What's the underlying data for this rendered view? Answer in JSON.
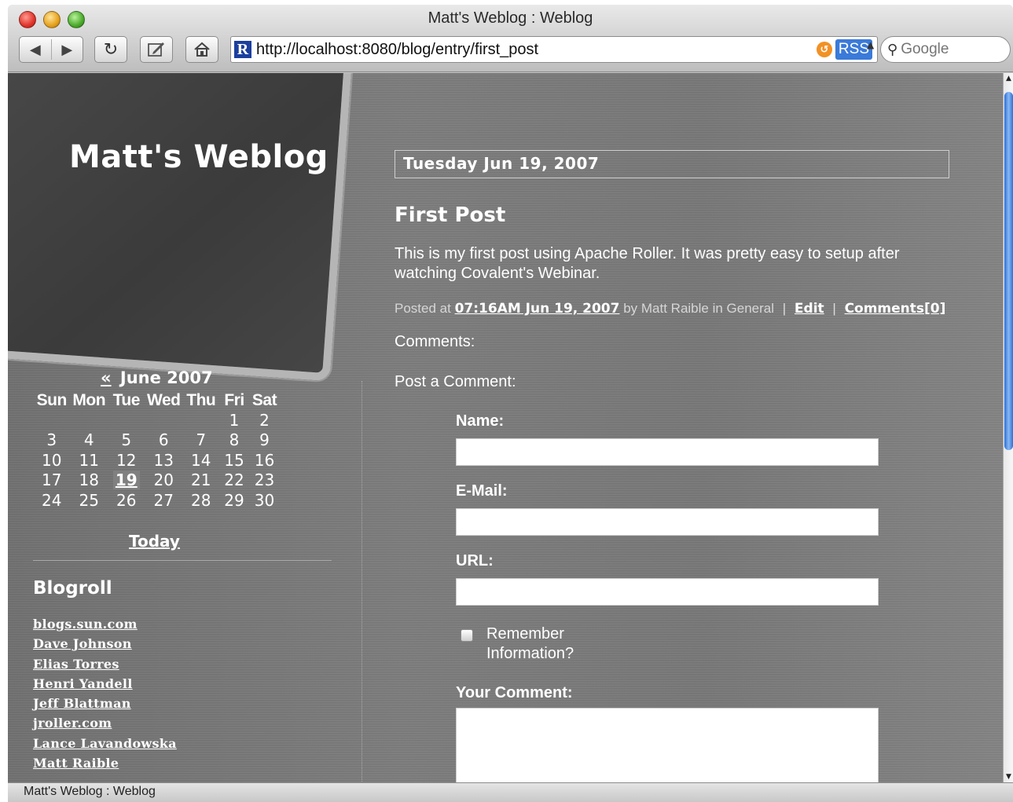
{
  "window": {
    "title": "Matt's Weblog : Weblog",
    "url": "http://localhost:8080/blog/entry/first_post",
    "rss_label": "RSS",
    "search_placeholder": "Google",
    "status_text": "Matt's Weblog : Weblog"
  },
  "header": {
    "site_title": "Matt's Weblog"
  },
  "calendar": {
    "prev_label": "«",
    "month_label": "June 2007",
    "days_of_week": [
      "Sun",
      "Mon",
      "Tue",
      "Wed",
      "Thu",
      "Fri",
      "Sat"
    ],
    "weeks": [
      [
        "",
        "",
        "",
        "",
        "",
        "1",
        "2"
      ],
      [
        "3",
        "4",
        "5",
        "6",
        "7",
        "8",
        "9"
      ],
      [
        "10",
        "11",
        "12",
        "13",
        "14",
        "15",
        "16"
      ],
      [
        "17",
        "18",
        "19",
        "20",
        "21",
        "22",
        "23"
      ],
      [
        "24",
        "25",
        "26",
        "27",
        "28",
        "29",
        "30"
      ]
    ],
    "active_day": "19",
    "today_label": "Today"
  },
  "blogroll": {
    "title": "Blogroll",
    "links": [
      "blogs.sun.com",
      "Dave Johnson",
      "Elias Torres",
      "Henri Yandell",
      "Jeff Blattman",
      "jroller.com",
      "Lance Lavandowska",
      "Matt Raible"
    ]
  },
  "post": {
    "date_heading": "Tuesday Jun 19, 2007",
    "title": "First Post",
    "body": "This is my first post using Apache Roller. It was pretty easy to setup after watching Covalent's Webinar.",
    "meta_posted_at": "Posted at",
    "meta_timestamp": "07:16AM Jun 19, 2007",
    "meta_by": "by Matt Raible in General",
    "meta_sep": "|",
    "edit_label": "Edit",
    "comments_link": "Comments[0]"
  },
  "comments": {
    "heading": "Comments:",
    "post_heading": "Post a Comment:",
    "name_label": "Name:",
    "email_label": "E-Mail:",
    "url_label": "URL:",
    "remember_label": "Remember Information?",
    "comment_label": "Your Comment:"
  }
}
